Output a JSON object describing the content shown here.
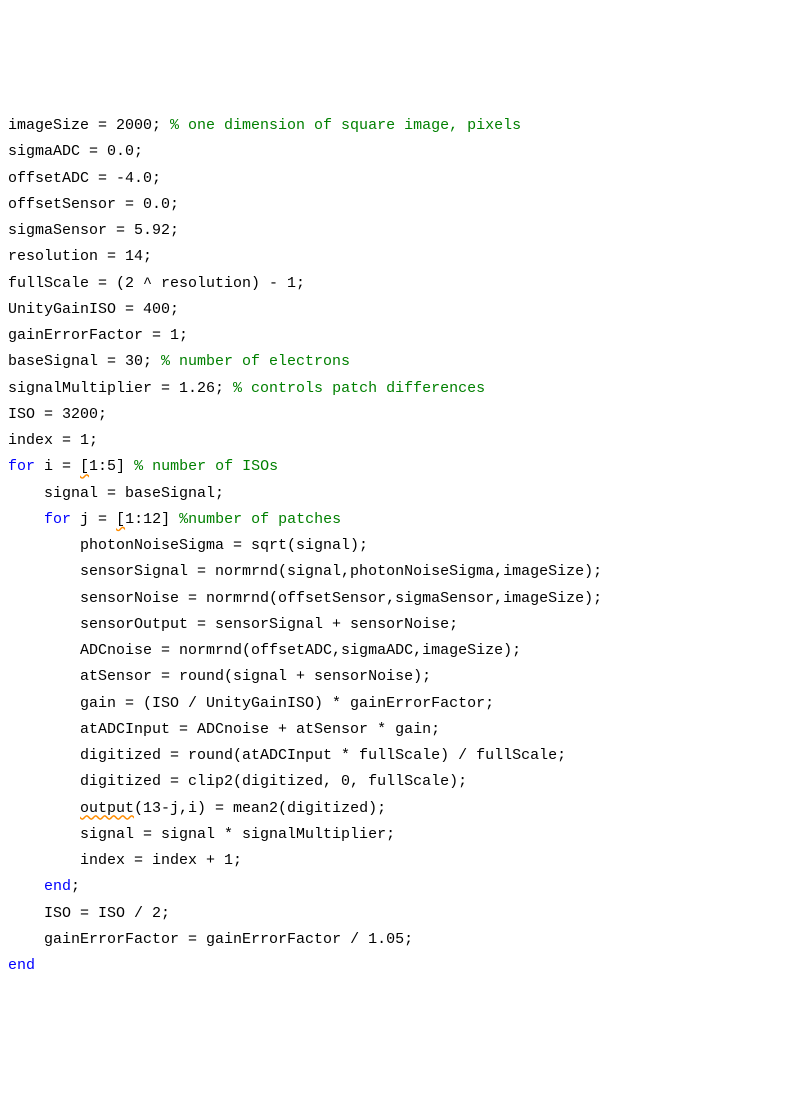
{
  "lines": [
    {
      "indent": 0,
      "parts": [
        {
          "t": "imageSize = 2000; ",
          "c": "var"
        },
        {
          "t": "% one dimension of square image, pixels",
          "c": "cm"
        }
      ]
    },
    {
      "indent": 0,
      "parts": [
        {
          "t": "sigmaADC = 0.0;",
          "c": "var"
        }
      ]
    },
    {
      "indent": 0,
      "parts": [
        {
          "t": "offsetADC = -4.0;",
          "c": "var"
        }
      ]
    },
    {
      "indent": 0,
      "parts": [
        {
          "t": "offsetSensor = 0.0;",
          "c": "var"
        }
      ]
    },
    {
      "indent": 0,
      "parts": [
        {
          "t": "sigmaSensor = 5.92;",
          "c": "var"
        }
      ]
    },
    {
      "indent": 0,
      "parts": [
        {
          "t": "resolution = 14;",
          "c": "var"
        }
      ]
    },
    {
      "indent": 0,
      "parts": [
        {
          "t": "fullScale = (2 ^ resolution) - 1;",
          "c": "var"
        }
      ]
    },
    {
      "indent": 0,
      "parts": [
        {
          "t": "UnityGainISO = 400;",
          "c": "var"
        }
      ]
    },
    {
      "indent": 0,
      "parts": [
        {
          "t": "gainErrorFactor = 1;",
          "c": "var"
        }
      ]
    },
    {
      "indent": 0,
      "parts": [
        {
          "t": "baseSignal = 30; ",
          "c": "var"
        },
        {
          "t": "% number of electrons",
          "c": "cm"
        }
      ]
    },
    {
      "indent": 0,
      "parts": [
        {
          "t": "signalMultiplier = 1.26; ",
          "c": "var"
        },
        {
          "t": "% controls patch differences",
          "c": "cm"
        }
      ]
    },
    {
      "indent": 0,
      "parts": [
        {
          "t": "ISO = 3200;",
          "c": "var"
        }
      ]
    },
    {
      "indent": 0,
      "parts": [
        {
          "t": "index = 1;",
          "c": "var"
        }
      ]
    },
    {
      "indent": 0,
      "parts": [
        {
          "t": "for",
          "c": "kw"
        },
        {
          "t": " i = ",
          "c": "var"
        },
        {
          "t": "[",
          "c": "warn"
        },
        {
          "t": "1:5] ",
          "c": "var"
        },
        {
          "t": "% number of ISOs",
          "c": "cm"
        }
      ]
    },
    {
      "indent": 1,
      "parts": [
        {
          "t": "signal = baseSignal;",
          "c": "var"
        }
      ]
    },
    {
      "indent": 1,
      "parts": [
        {
          "t": "for",
          "c": "kw"
        },
        {
          "t": " j = ",
          "c": "var"
        },
        {
          "t": "[",
          "c": "warn"
        },
        {
          "t": "1:12] ",
          "c": "var"
        },
        {
          "t": "%number of patches",
          "c": "cm"
        }
      ]
    },
    {
      "indent": 2,
      "parts": [
        {
          "t": "photonNoiseSigma = sqrt(signal);",
          "c": "var"
        }
      ]
    },
    {
      "indent": 2,
      "parts": [
        {
          "t": "sensorSignal = normrnd(signal,photonNoiseSigma,imageSize);",
          "c": "var"
        }
      ]
    },
    {
      "indent": 2,
      "parts": [
        {
          "t": "sensorNoise = normrnd(offsetSensor,sigmaSensor,imageSize);",
          "c": "var"
        }
      ]
    },
    {
      "indent": 2,
      "parts": [
        {
          "t": "sensorOutput = sensorSignal + sensorNoise;",
          "c": "var"
        }
      ]
    },
    {
      "indent": 2,
      "parts": [
        {
          "t": "ADCnoise = normrnd(offsetADC,sigmaADC,imageSize);",
          "c": "var"
        }
      ]
    },
    {
      "indent": 2,
      "parts": [
        {
          "t": "atSensor = round(signal + sensorNoise);",
          "c": "var"
        }
      ]
    },
    {
      "indent": 2,
      "parts": [
        {
          "t": "gain = (ISO / UnityGainISO) * gainErrorFactor;",
          "c": "var"
        }
      ]
    },
    {
      "indent": 2,
      "parts": [
        {
          "t": "atADCInput = ADCnoise + atSensor * gain;",
          "c": "var"
        }
      ]
    },
    {
      "indent": 2,
      "parts": [
        {
          "t": "digitized = round(atADCInput * fullScale) / fullScale;",
          "c": "var"
        }
      ]
    },
    {
      "indent": 2,
      "parts": [
        {
          "t": "digitized = clip2(digitized, 0, fullScale);",
          "c": "var"
        }
      ]
    },
    {
      "indent": 2,
      "parts": [
        {
          "t": "output",
          "c": "warn"
        },
        {
          "t": "(13-j,i) = mean2(digitized);",
          "c": "var"
        }
      ]
    },
    {
      "indent": 2,
      "parts": [
        {
          "t": "signal = signal * signalMultiplier;",
          "c": "var"
        }
      ]
    },
    {
      "indent": 2,
      "parts": [
        {
          "t": "index = index + 1;",
          "c": "var"
        }
      ]
    },
    {
      "indent": 1,
      "parts": [
        {
          "t": "end",
          "c": "kw"
        },
        {
          "t": ";",
          "c": "var"
        }
      ]
    },
    {
      "indent": 1,
      "parts": [
        {
          "t": "ISO = ISO / 2;",
          "c": "var"
        }
      ]
    },
    {
      "indent": 1,
      "parts": [
        {
          "t": "gainErrorFactor = gainErrorFactor / 1.05;",
          "c": "var"
        }
      ]
    },
    {
      "indent": 0,
      "parts": [
        {
          "t": "end",
          "c": "kw"
        }
      ]
    }
  ]
}
